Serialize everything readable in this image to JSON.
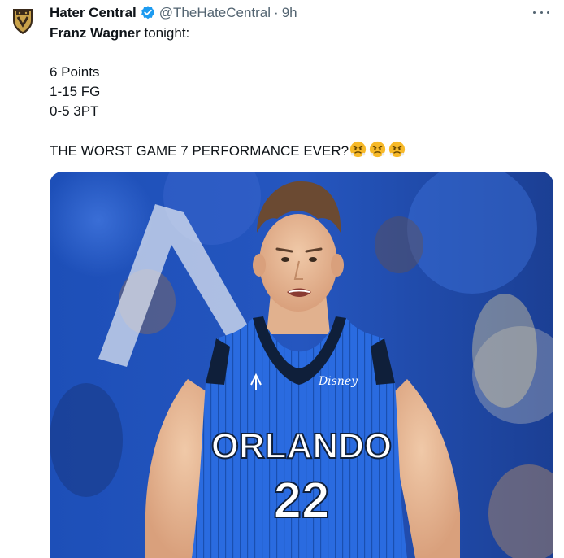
{
  "author": {
    "display_name": "Hater Central",
    "handle": "@TheHateCentral",
    "separator": "·",
    "time": "9h",
    "avatar_icon": "shield-logo-icon",
    "verified_icon": "verified-badge-icon"
  },
  "tweet": {
    "mention": "Franz Wagner",
    "after_mention": " tonight:",
    "stats": [
      "6 Points",
      "1-15 FG",
      "0-5 3PT"
    ],
    "headline": "THE WORST GAME 7 PERFORMANCE EVER?",
    "emoji_icon": "face-with-steam-from-nose-icon",
    "emoji_count": 3
  },
  "media": {
    "jersey_team": "ORLANDO",
    "jersey_number": "22",
    "jersey_sponsor": "Disney",
    "jersey_color": "#1f5fd8",
    "description_icon": "basketball-player-photo"
  },
  "colors": {
    "text": "#0f1419",
    "secondary": "#536471",
    "verified": "#1d9bf0"
  }
}
